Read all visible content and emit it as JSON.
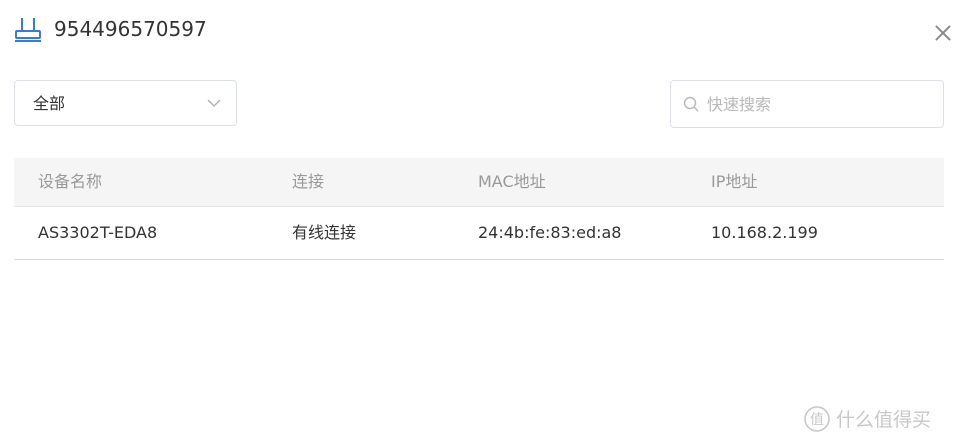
{
  "header": {
    "title": "954496570597",
    "icon": "router-icon"
  },
  "filter": {
    "selected": "全部",
    "icon": "chevron-down-icon"
  },
  "search": {
    "placeholder": "快速搜索",
    "value": ""
  },
  "table": {
    "columns": [
      "设备名称",
      "连接",
      "MAC地址",
      "IP地址"
    ],
    "rows": [
      [
        "AS3302T-EDA8",
        "有线连接",
        "24:4b:fe:83:ed:a8",
        "10.168.2.199"
      ]
    ]
  },
  "watermark": {
    "text": "什么值得买"
  },
  "colors": {
    "accent": "#3a7bd5",
    "header_bg": "#f5f5f5",
    "border": "#dcdfe6"
  }
}
